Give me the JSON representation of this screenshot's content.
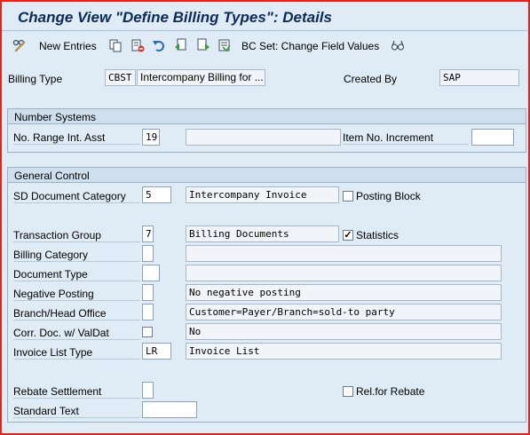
{
  "window": {
    "title": "Change View \"Define Billing Types\": Details"
  },
  "toolbar": {
    "new_entries": "New Entries",
    "bc_set": "BC Set: Change Field Values"
  },
  "header": {
    "billing_type_label": "Billing Type",
    "billing_type_code": "CBST",
    "billing_type_desc": "Intercompany Billing for ...",
    "created_by_label": "Created By",
    "created_by_value": "SAP"
  },
  "number_systems": {
    "title": "Number Systems",
    "no_range_label": "No. Range Int. Asst",
    "no_range_value": "19",
    "no_range_desc": "",
    "item_no_inc_label": "Item No. Increment",
    "item_no_inc_value": ""
  },
  "general_control": {
    "title": "General Control",
    "sd_doc_cat_label": "SD Document Category",
    "sd_doc_cat_value": "5",
    "sd_doc_cat_desc": "Intercompany Invoice",
    "posting_block_label": "Posting Block",
    "posting_block_checked": false,
    "trans_group_label": "Transaction Group",
    "trans_group_value": "7",
    "trans_group_desc": "Billing Documents",
    "statistics_label": "Statistics",
    "statistics_checked": true,
    "statistics_mark": "✓",
    "billing_cat_label": "Billing Category",
    "billing_cat_value": "",
    "billing_cat_desc": "",
    "doc_type_label": "Document Type",
    "doc_type_value": "",
    "doc_type_desc": "",
    "neg_posting_label": "Negative Posting",
    "neg_posting_value": "",
    "neg_posting_desc": "No negative posting",
    "branch_label": "Branch/Head Office",
    "branch_value": "",
    "branch_desc": "Customer=Payer/Branch=sold-to party",
    "corr_doc_label": "Corr. Doc. w/ ValDat",
    "corr_doc_checked": false,
    "corr_doc_desc": "No",
    "invoice_list_label": "Invoice List Type",
    "invoice_list_value": "LR",
    "invoice_list_desc": "Invoice List",
    "rebate_label": "Rebate Settlement",
    "rebate_value": "",
    "rel_rebate_label": "Rel.for Rebate",
    "rel_rebate_checked": false,
    "std_text_label": "Standard Text",
    "std_text_value": ""
  },
  "colors": {
    "frame": "#e0261c",
    "title": "#0d2a58",
    "background": "#dfebf5"
  }
}
